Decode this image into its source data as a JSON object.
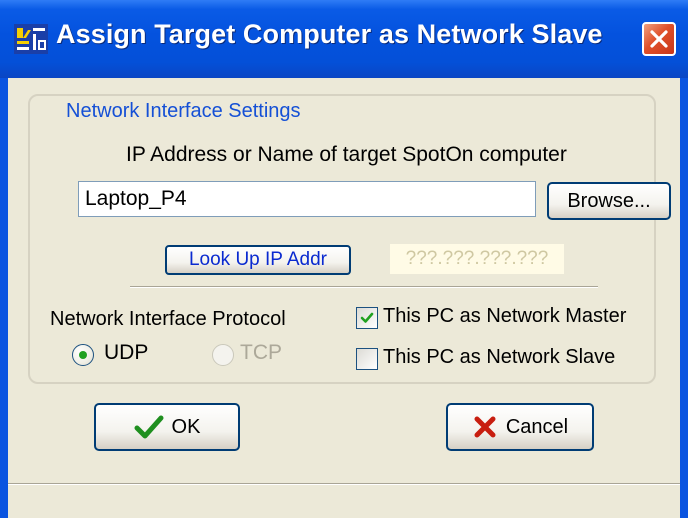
{
  "window": {
    "title": "Assign Target Computer as Network Slave",
    "app_icon": "spoton-app-icon",
    "close_icon": "close-icon",
    "colors": {
      "titlebar": "#0452de",
      "close": "#e0502a",
      "client": "#ece9d8",
      "legend": "#1550d6"
    }
  },
  "group": {
    "legend": "Network Interface Settings",
    "ip_prompt": "IP Address or Name of target SpotOn computer",
    "target_value": "Laptop_P4",
    "browse_label": "Browse...",
    "lookup_label": "Look Up IP Addr",
    "ip_display": "???.???.???.???",
    "protocol_label": "Network Interface Protocol",
    "protocol_options": [
      {
        "label": "UDP",
        "selected": true,
        "enabled": true
      },
      {
        "label": "TCP",
        "selected": false,
        "enabled": false
      }
    ],
    "master_label": "This PC as Network Master",
    "master_checked": true,
    "slave_label": "This PC as Network Slave",
    "slave_checked": false
  },
  "buttons": {
    "ok_label": "OK",
    "ok_icon": "checkmark-icon",
    "cancel_label": "Cancel",
    "cancel_icon": "x-mark-icon"
  }
}
